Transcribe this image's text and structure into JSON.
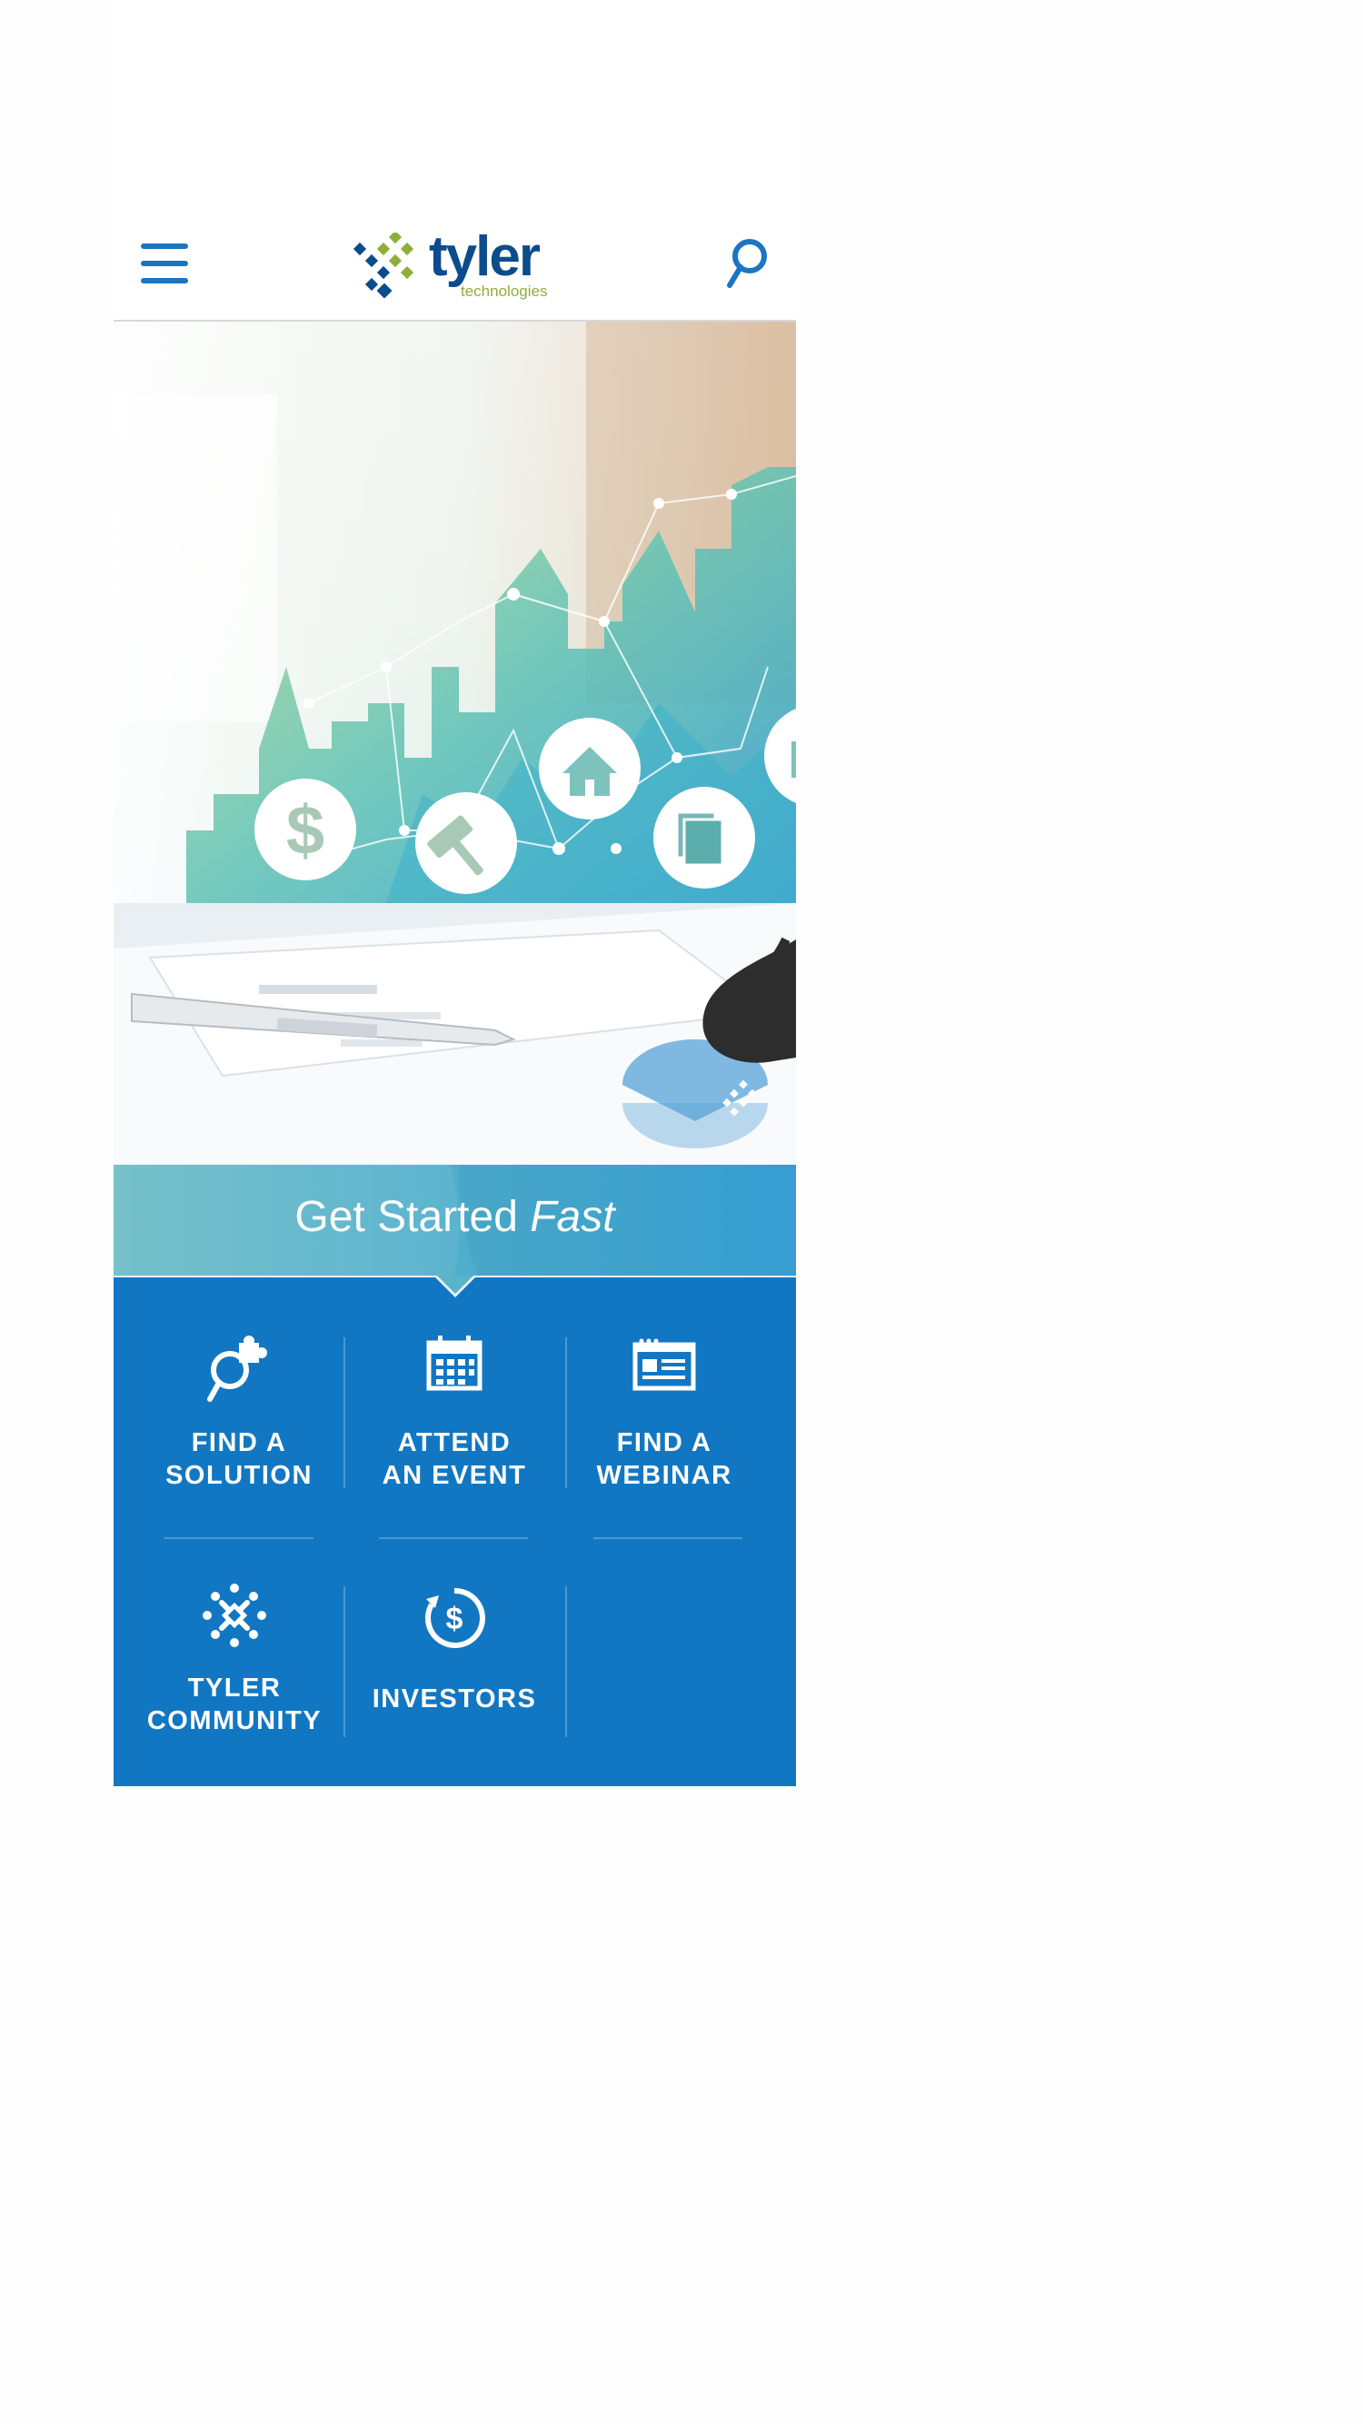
{
  "header": {
    "menu_icon": "hamburger-menu-icon",
    "logo_word": "tyler",
    "logo_sub": "technologies",
    "search_icon": "search-icon",
    "colors": {
      "brand_blue": "#0b4c8c",
      "brand_green": "#8eae3a",
      "accent": "#1a75c2"
    }
  },
  "hero": {
    "icons": [
      "dollar-icon",
      "gavel-icon",
      "house-icon",
      "documents-icon",
      "building-icon"
    ],
    "corner_logo_icon": "tyler-diamond-icon"
  },
  "get_started": {
    "title_plain": "Get Started ",
    "title_emphasis": "Fast"
  },
  "quick_links": {
    "background": "#1277c2",
    "items": [
      {
        "label_line1": "FIND A",
        "label_line2": "SOLUTION",
        "icon": "magnifier-puzzle-icon"
      },
      {
        "label_line1": "ATTEND",
        "label_line2": "AN EVENT",
        "icon": "calendar-icon"
      },
      {
        "label_line1": "FIND A",
        "label_line2": "WEBINAR",
        "icon": "browser-window-icon"
      },
      {
        "label_line1": "TYLER",
        "label_line2": "COMMUNITY",
        "icon": "community-icon"
      },
      {
        "label_line1": "INVESTORS",
        "label_line2": "",
        "icon": "dollar-circle-icon"
      }
    ]
  }
}
